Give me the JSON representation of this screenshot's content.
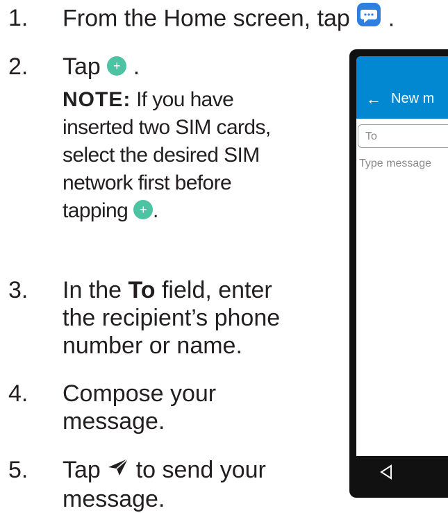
{
  "steps": [
    {
      "num": "1.",
      "text_before": "From the Home screen, tap ",
      "text_after": ".",
      "icon": "messages-app-icon"
    },
    {
      "num": "2.",
      "text_before": "Tap ",
      "text_after": ".",
      "icon": "new-message-plus-icon"
    },
    {
      "num": "3.",
      "line1_before": "In the ",
      "bold": "To",
      "line1_after": " field, enter",
      "line2": "the recipient’s phone",
      "line3": "number or name."
    },
    {
      "num": "4.",
      "line1": "Compose your",
      "line2": "message."
    },
    {
      "num": "5.",
      "line1_before": "Tap ",
      "line1_after": " to send your",
      "line2": "message.",
      "icon": "send-icon"
    }
  ],
  "note": {
    "label": "NOTE:",
    "line1": " If you have",
    "line2": "inserted two SIM cards,",
    "line3": "select the desired SIM",
    "line4": "network first before",
    "line5_before": "tapping ",
    "line5_after": "."
  },
  "plus_glyph": "+",
  "phone": {
    "back_arrow": "←",
    "title": "New m",
    "to_placeholder": "To",
    "message_placeholder": "Type message",
    "accent_color": "#0288d1"
  },
  "colors": {
    "text": "#231f20",
    "plus_icon": "#4dc3a4",
    "messages_icon": "#2f7fe0"
  }
}
